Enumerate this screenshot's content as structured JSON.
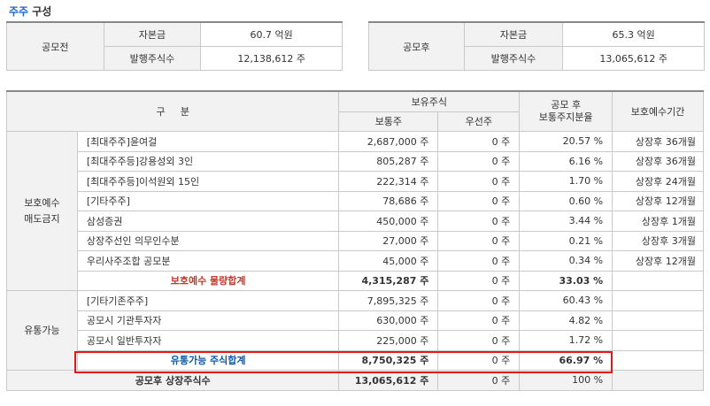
{
  "title": {
    "accent": "주주",
    "rest": " 구성"
  },
  "before": {
    "label": "공모전",
    "capital_label": "자본금",
    "capital_value": "60.7 억원",
    "shares_label": "발행주식수",
    "shares_value": "12,138,612 주"
  },
  "after": {
    "label": "공모후",
    "capital_label": "자본금",
    "capital_value": "65.3 억원",
    "shares_label": "발행주식수",
    "shares_value": "13,065,612 주"
  },
  "header": {
    "category": "구     분",
    "holdings": "보유주식",
    "common": "보통주",
    "preferred": "우선주",
    "ratio_line1": "공모 후",
    "ratio_line2": "보통주지분율",
    "lockup": "보호예수기간"
  },
  "groups": {
    "protected": {
      "label_line1": "보호예수",
      "label_line2": "매도금지"
    },
    "tradable": {
      "label": "유통가능"
    }
  },
  "protected_rows": [
    {
      "name": "[최대주주]윤여걸",
      "common": "2,687,000 주",
      "preferred": "0 주",
      "ratio": "20.57 %",
      "period": "상장후 36개월"
    },
    {
      "name": "[최대주주등]강용성외 3인",
      "common": "805,287 주",
      "preferred": "0 주",
      "ratio": "6.16 %",
      "period": "상장후 36개월"
    },
    {
      "name": "[최대주주등]이석원외 15인",
      "common": "222,314 주",
      "preferred": "0 주",
      "ratio": "1.70 %",
      "period": "상장후 24개월"
    },
    {
      "name": "[기타주주]",
      "common": "78,686 주",
      "preferred": "0 주",
      "ratio": "0.60 %",
      "period": "상장후 12개월"
    },
    {
      "name": "삼성증권",
      "common": "450,000 주",
      "preferred": "0 주",
      "ratio": "3.44 %",
      "period": "상장후 1개월"
    },
    {
      "name": "상장주선인 의무인수분",
      "common": "27,000 주",
      "preferred": "0 주",
      "ratio": "0.21 %",
      "period": "상장후 3개월"
    },
    {
      "name": "우리사주조합 공모분",
      "common": "45,000 주",
      "preferred": "0 주",
      "ratio": "0.34 %",
      "period": "상장후 12개월"
    }
  ],
  "protected_sum": {
    "name": "보호예수 물량합계",
    "common": "4,315,287 주",
    "preferred": "0 주",
    "ratio": "33.03 %"
  },
  "tradable_rows": [
    {
      "name": "[기타기존주주]",
      "common": "7,895,325 주",
      "preferred": "0 주",
      "ratio": "60.43 %"
    },
    {
      "name": "공모시 기관투자자",
      "common": "630,000 주",
      "preferred": "0 주",
      "ratio": "4.82 %"
    },
    {
      "name": "공모시 일반투자자",
      "common": "225,000 주",
      "preferred": "0 주",
      "ratio": "1.72 %"
    }
  ],
  "tradable_sum": {
    "name": "유통가능 주식합계",
    "common": "8,750,325 주",
    "preferred": "0 주",
    "ratio": "66.97 %"
  },
  "grand": {
    "name": "공모후 상장주식수",
    "common": "13,065,612 주",
    "preferred": "0 주",
    "ratio": "100 %"
  },
  "colors": {
    "accent": "#1a66c9",
    "highlight_box": "#e8141a",
    "protected_sum_text": "#c0392b",
    "tradable_sum_text": "#0b5aa8"
  }
}
